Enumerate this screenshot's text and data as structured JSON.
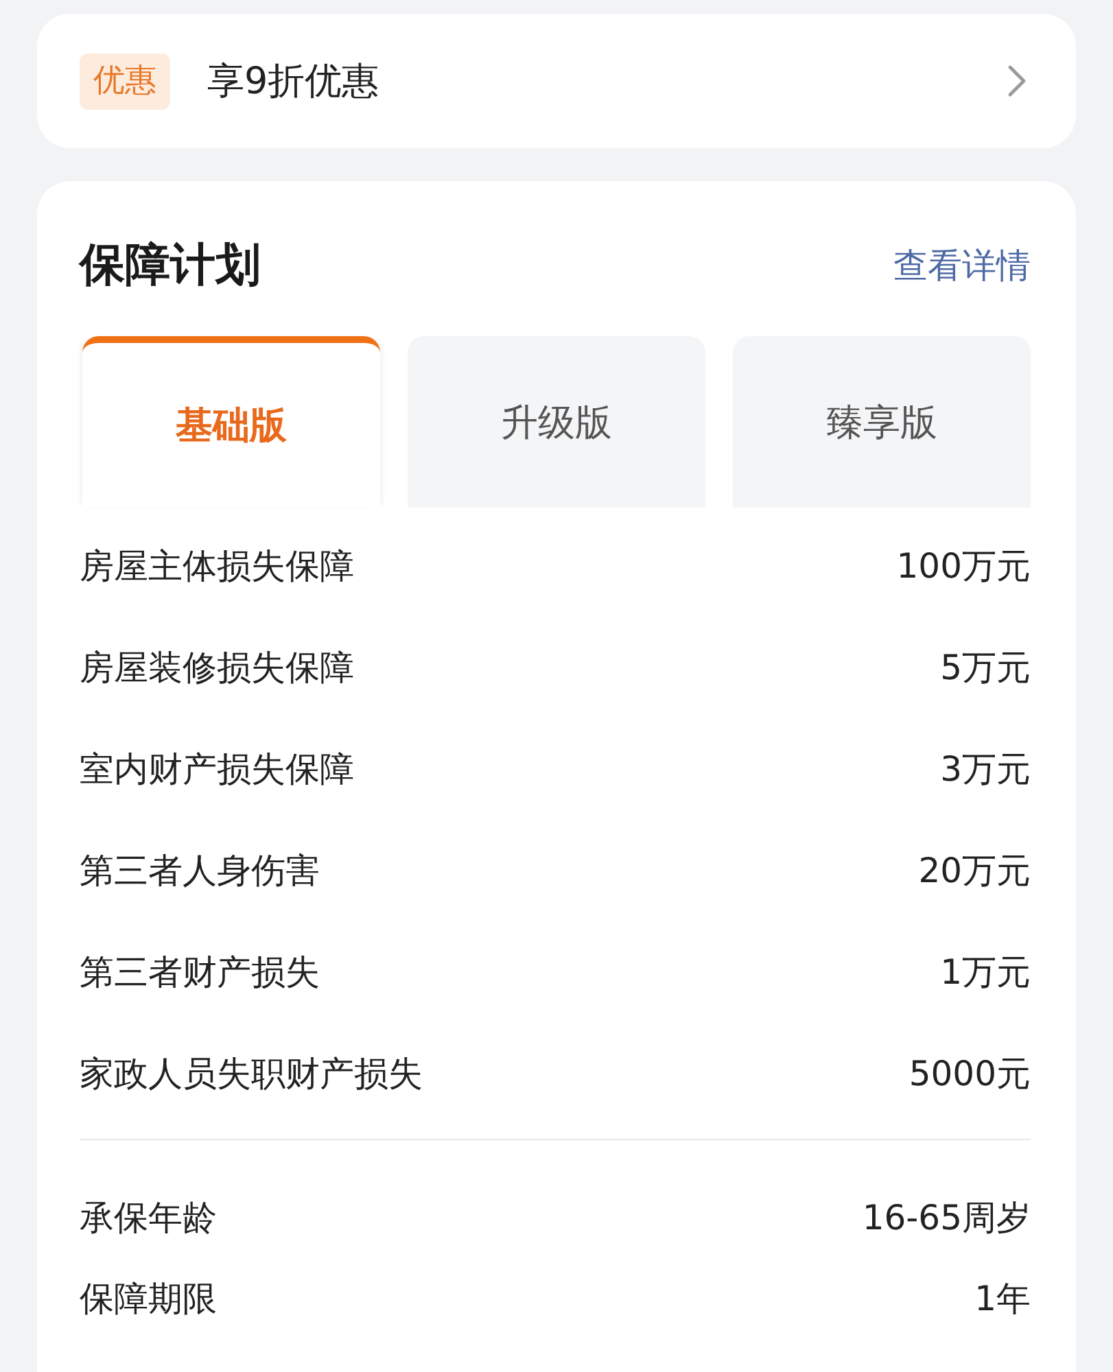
{
  "promo": {
    "tag": "优惠",
    "text": "享9折优惠"
  },
  "plan": {
    "title": "保障计划",
    "link": "查看详情",
    "tabs": [
      {
        "label": "基础版",
        "selected": true
      },
      {
        "label": "升级版",
        "selected": false
      },
      {
        "label": "臻享版",
        "selected": false
      }
    ],
    "coverage": [
      {
        "name": "房屋主体损失保障",
        "amount": "100万元"
      },
      {
        "name": "房屋装修损失保障",
        "amount": "5万元"
      },
      {
        "name": "室内财产损失保障",
        "amount": "3万元"
      },
      {
        "name": "第三者人身伤害",
        "amount": "20万元"
      },
      {
        "name": "第三者财产损失",
        "amount": "1万元"
      },
      {
        "name": "家政人员失职财产损失",
        "amount": "5000元"
      }
    ],
    "terms": [
      {
        "name": "承保年龄",
        "value": "16-65周岁"
      },
      {
        "name": "保障期限",
        "value": "1年"
      }
    ]
  }
}
